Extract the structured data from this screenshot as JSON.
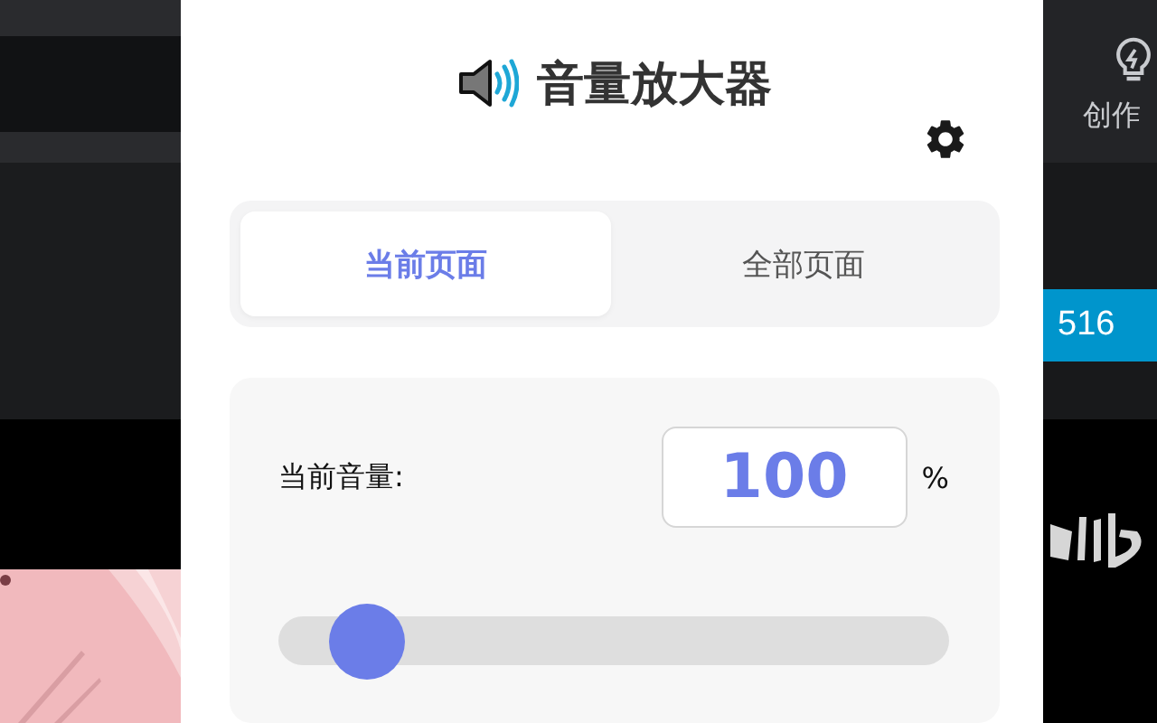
{
  "background_page": {
    "header_link": "创作",
    "badge": "516"
  },
  "popup": {
    "title": "音量放大器",
    "tabs": [
      {
        "label": "当前页面",
        "selected": true
      },
      {
        "label": "全部页面",
        "selected": false
      }
    ],
    "volume": {
      "label": "当前音量:",
      "value": "100",
      "unit": "%",
      "level": 0.085
    }
  }
}
